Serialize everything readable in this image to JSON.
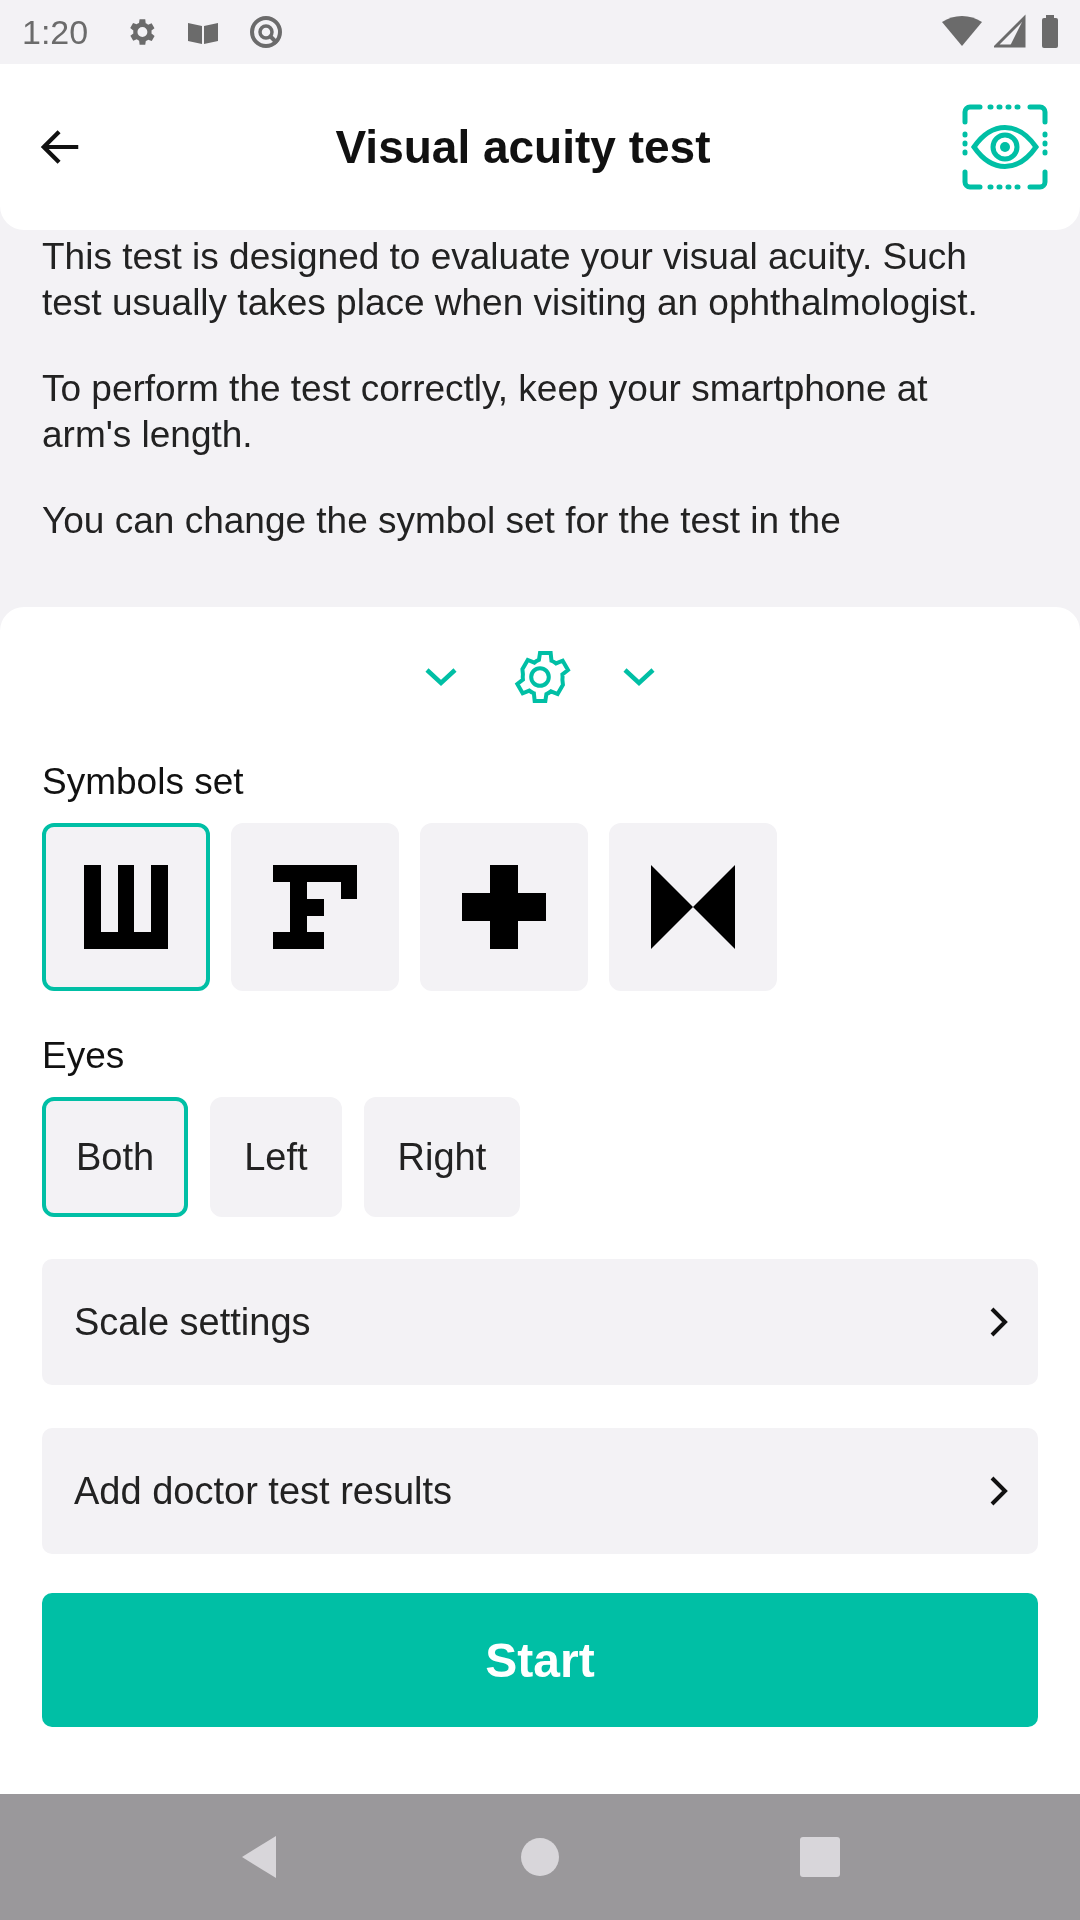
{
  "status_bar": {
    "time": "1:20"
  },
  "header": {
    "title": "Visual acuity test"
  },
  "description": [
    "This test is designed to evaluate your visual acuity. Such test usually takes place when visiting an ophthalmologist.",
    "To perform the test correctly, keep your smartphone at arm's length.",
    "You can change the symbol set for the test in the"
  ],
  "symbols_set": {
    "label": "Symbols set",
    "options": [
      {
        "kind": "tumbling-e",
        "selected": true
      },
      {
        "kind": "f-letter",
        "selected": false
      },
      {
        "kind": "cross",
        "selected": false
      },
      {
        "kind": "bowtie",
        "selected": false
      }
    ]
  },
  "eyes": {
    "label": "Eyes",
    "options": [
      {
        "label": "Both",
        "selected": true
      },
      {
        "label": "Left",
        "selected": false
      },
      {
        "label": "Right",
        "selected": false
      }
    ]
  },
  "menu_rows": [
    {
      "label": "Scale settings"
    },
    {
      "label": "Add doctor test results"
    }
  ],
  "start_button": "Start"
}
